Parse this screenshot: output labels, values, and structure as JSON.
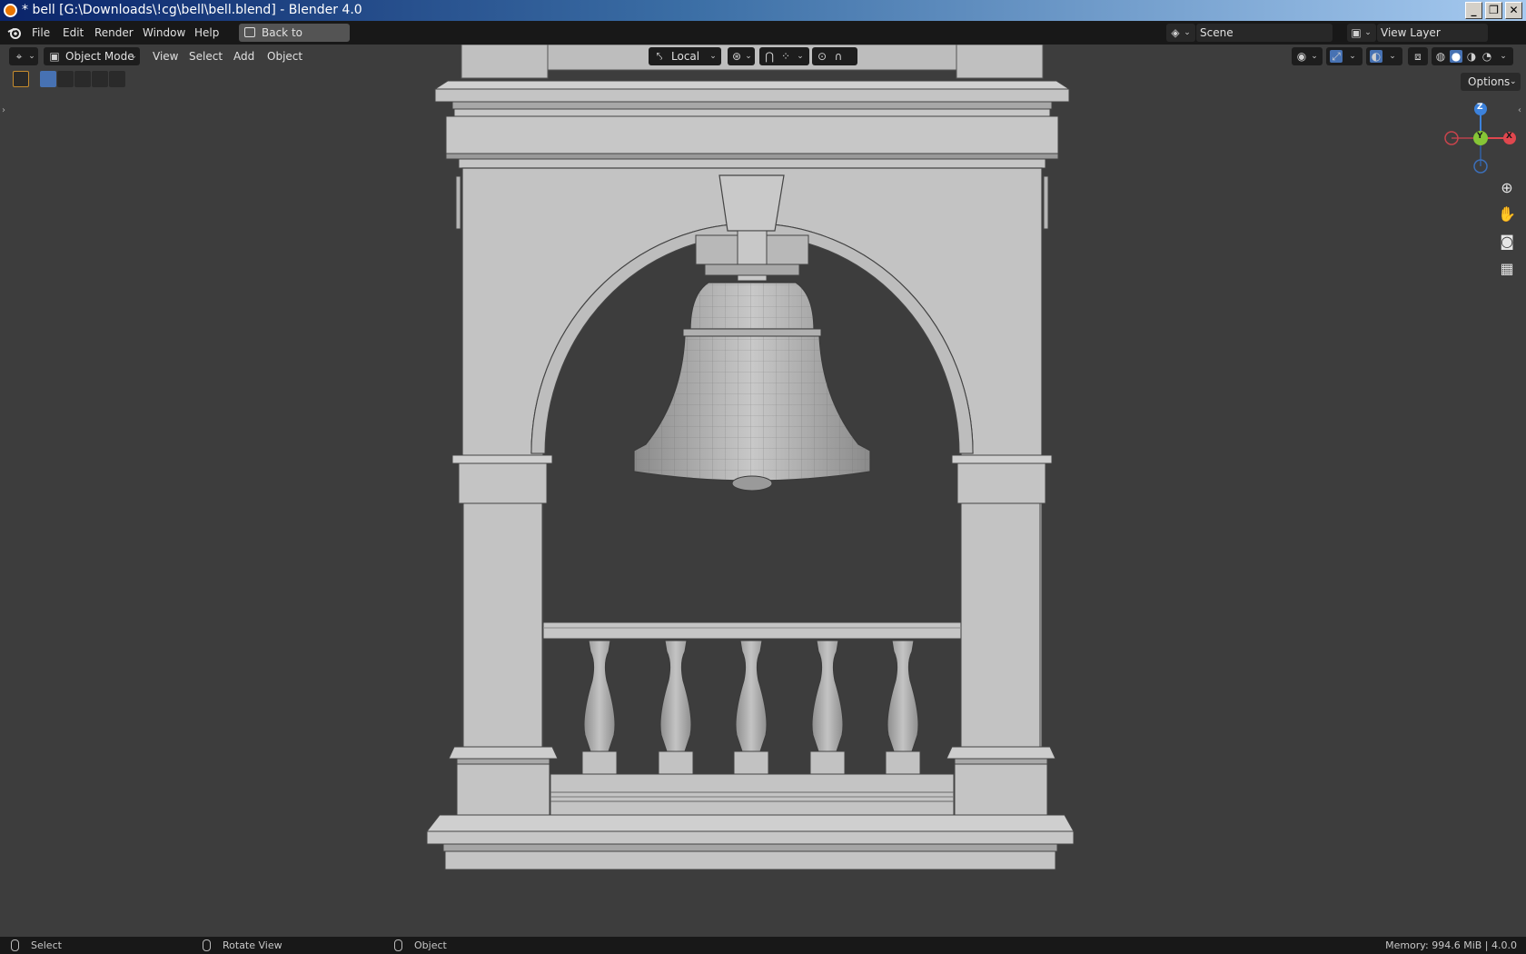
{
  "window": {
    "title": "* bell [G:\\Downloads\\!cg\\bell\\bell.blend] - Blender 4.0",
    "controls": [
      "_",
      "❐",
      "✕"
    ]
  },
  "menubar": {
    "items": [
      "File",
      "Edit",
      "Render",
      "Window",
      "Help"
    ],
    "back_button": "Back to Previous",
    "scene": "Scene",
    "view_layer": "View Layer"
  },
  "viewport_header": {
    "mode": "Object Mode",
    "menus": [
      "View",
      "Select",
      "Add",
      "Object"
    ],
    "transform_orientation": "Local"
  },
  "viewport": {
    "options_label": "Options",
    "gizmo": {
      "z": "Z",
      "y": "Y",
      "x": "X"
    }
  },
  "statusbar": {
    "left_action": "Select",
    "middle_action": "Rotate View",
    "right_action": "Object",
    "memory": "Memory: 994.6 MiB | 4.0.0"
  },
  "colors": {
    "x_axis": "#e0474e",
    "y_axis": "#86c536",
    "z_axis": "#3c82dc",
    "accent": "#4772b3"
  }
}
